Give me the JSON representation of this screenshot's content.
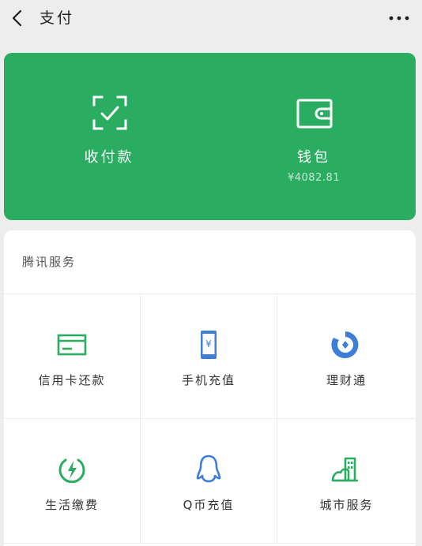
{
  "header": {
    "title": "支付",
    "back_icon": "chevron-left-icon",
    "more_icon": "more-dots-icon"
  },
  "wallet_card": {
    "background": "#2aad60",
    "actions": [
      {
        "label": "收付款",
        "icon": "scan-check-icon"
      },
      {
        "label": "钱包",
        "icon": "wallet-icon",
        "balance": "¥4082.81"
      }
    ]
  },
  "services": {
    "section_title": "腾讯服务",
    "items": [
      {
        "label": "信用卡还款",
        "icon": "credit-card-icon",
        "color": "#2aad60"
      },
      {
        "label": "手机充值",
        "icon": "phone-recharge-icon",
        "color": "#3d7fd6"
      },
      {
        "label": "理财通",
        "icon": "wealth-icon",
        "color": "#3d7fd6"
      },
      {
        "label": "生活缴费",
        "icon": "utility-bolt-icon",
        "color": "#2aad60"
      },
      {
        "label": "Q币充值",
        "icon": "qq-penguin-icon",
        "color": "#3d7fd6"
      },
      {
        "label": "城市服务",
        "icon": "city-buildings-icon",
        "color": "#2aad60"
      }
    ]
  }
}
